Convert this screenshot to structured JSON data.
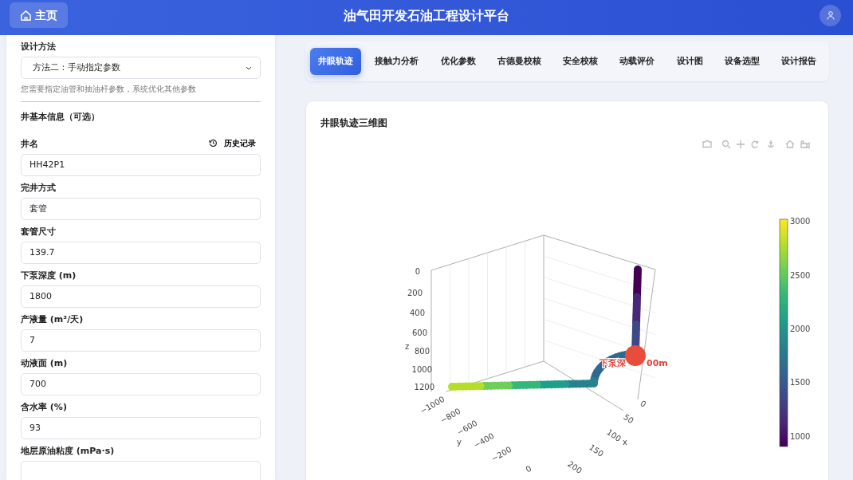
{
  "header": {
    "home_button": "主页",
    "title": "油气田开发石油工程设计平台"
  },
  "form": {
    "method": {
      "label": "设计方法",
      "value": "方法二：手动指定参数",
      "help": "您需要指定油管和抽油杆参数，系统优化其他参数"
    },
    "section_title": "井基本信息（可选）",
    "history_button": "历史记录",
    "fields": [
      {
        "label": "井名",
        "value": "HH42P1"
      },
      {
        "label": "完井方式",
        "value": "套管"
      },
      {
        "label": "套管尺寸",
        "value": "139.7"
      },
      {
        "label": "下泵深度 (m)",
        "value": "1800"
      },
      {
        "label": "产液量 (m³/天)",
        "value": "7"
      },
      {
        "label": "动液面 (m)",
        "value": "700"
      },
      {
        "label": "含水率 (%)",
        "value": "93"
      },
      {
        "label": "地层原油粘度 (mPa·s)"
      }
    ]
  },
  "tabs": [
    {
      "label": "井眼轨迹",
      "selected": true
    },
    {
      "label": "接触力分析",
      "selected": false
    },
    {
      "label": "优化参数",
      "selected": false
    },
    {
      "label": "古德曼校核",
      "selected": false
    },
    {
      "label": "安全校核",
      "selected": false
    },
    {
      "label": "动载评价",
      "selected": false
    },
    {
      "label": "设计图",
      "selected": false
    },
    {
      "label": "设备选型",
      "selected": false
    },
    {
      "label": "设计报告",
      "selected": false
    }
  ],
  "plot": {
    "title": "井眼轨迹三维图",
    "z_label": "z",
    "z_ticks": [
      "0",
      "200",
      "400",
      "600",
      "800",
      "1000",
      "1200"
    ],
    "y_label": "y",
    "y_ticks": [
      "−1000",
      "−800",
      "−600",
      "−400",
      "−200",
      "0"
    ],
    "x_label": "x",
    "x_ticks": [
      "0",
      "50",
      "100",
      "150",
      "200"
    ],
    "annotation": [
      "下泵深",
      "00m"
    ],
    "colorbar_ticks": [
      "3000",
      "2500",
      "2000",
      "1500",
      "1000"
    ]
  }
}
